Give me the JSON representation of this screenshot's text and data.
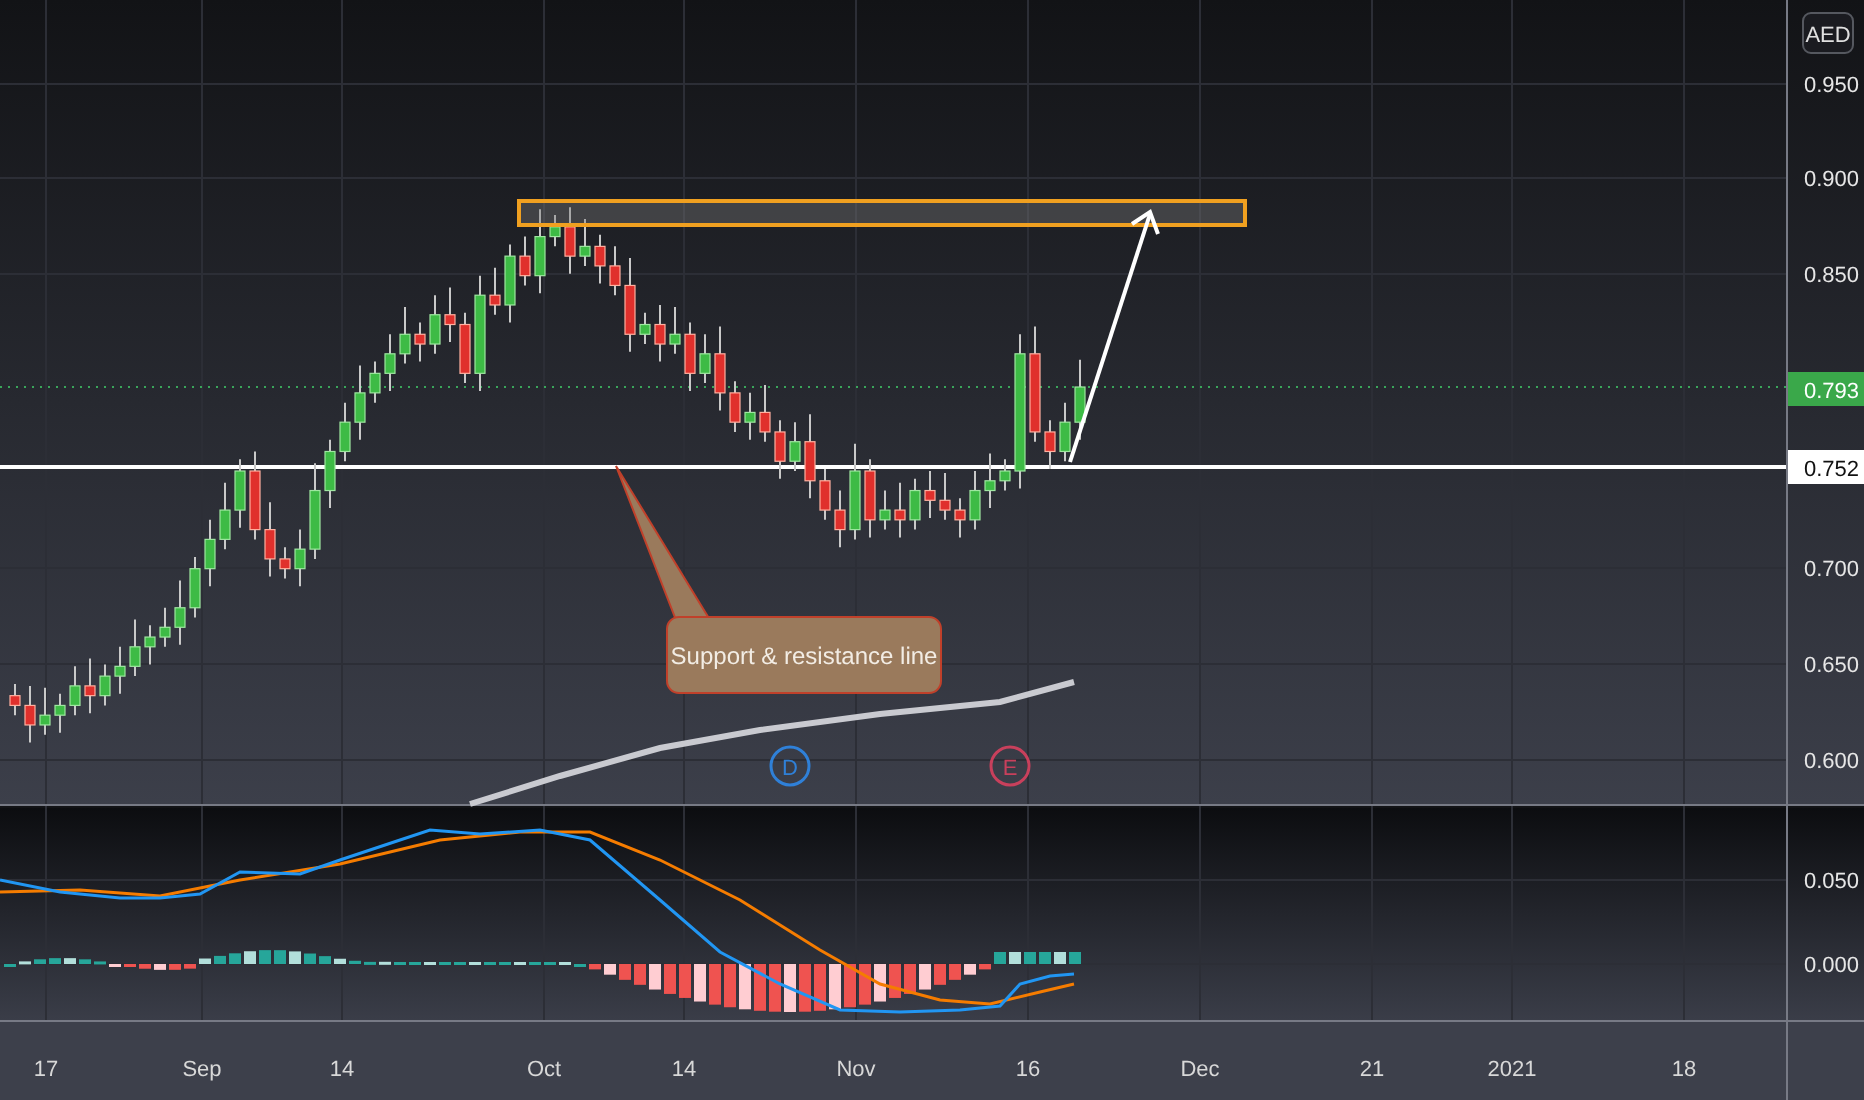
{
  "price_axis": {
    "currency": "AED",
    "ticks": [
      "0.950",
      "0.900",
      "0.850",
      "0.700",
      "0.650",
      "0.600"
    ],
    "last_price": "0.793",
    "line_price": "0.752"
  },
  "macd_axis": {
    "ticks": [
      "0.050",
      "0.000"
    ]
  },
  "time_axis": {
    "labels": [
      "17",
      "Sep",
      "14",
      "Oct",
      "14",
      "Nov",
      "16",
      "Dec",
      "21",
      "2021",
      "18"
    ]
  },
  "annotation": {
    "text": "Support & resistance line"
  },
  "event_markers": [
    {
      "letter": "D",
      "color": "#2f80d8"
    },
    {
      "letter": "E",
      "color": "#c8405c"
    }
  ]
}
